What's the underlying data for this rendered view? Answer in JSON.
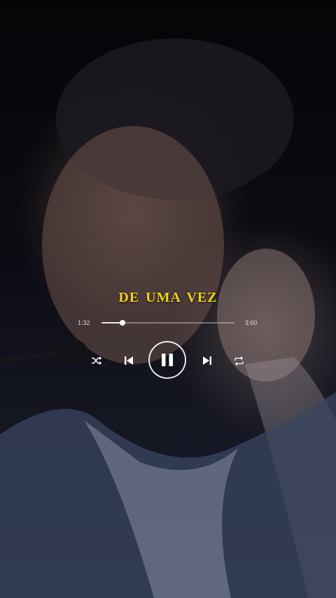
{
  "player": {
    "song_title": "DE UMA VEZ",
    "time_elapsed": "1:32",
    "time_total": "3:60",
    "progress_fraction": 0.16,
    "state": "playing"
  },
  "controls": {
    "shuffle_icon": "shuffle-icon",
    "previous_icon": "skip-previous-icon",
    "play_pause_icon": "pause-icon",
    "next_icon": "skip-next-icon",
    "repeat_icon": "repeat-icon"
  },
  "colors": {
    "title": "#f0d21e",
    "controls": "#ffffff"
  }
}
